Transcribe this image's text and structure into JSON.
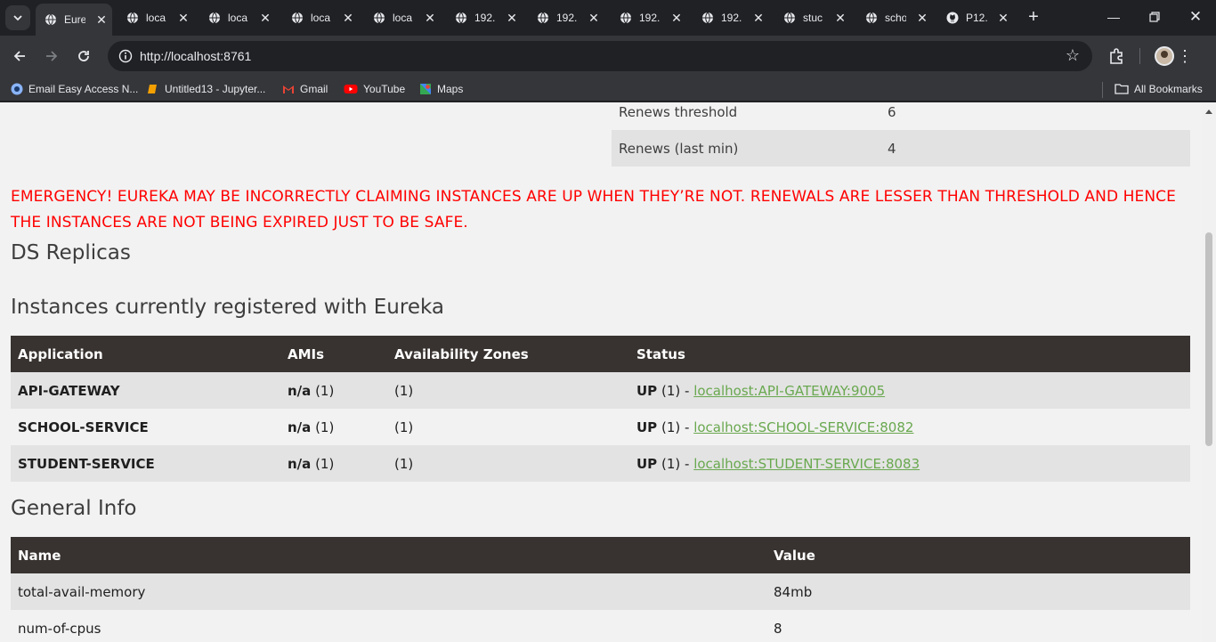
{
  "browser": {
    "tabs": [
      {
        "title": "Eure",
        "icon": "leaf-icon",
        "active": true
      },
      {
        "title": "loca",
        "icon": "globe-icon"
      },
      {
        "title": "loca",
        "icon": "globe-icon"
      },
      {
        "title": "loca",
        "icon": "globe-icon"
      },
      {
        "title": "loca",
        "icon": "globe-icon"
      },
      {
        "title": "192.",
        "icon": "globe-icon"
      },
      {
        "title": "192.",
        "icon": "globe-icon"
      },
      {
        "title": "192.",
        "icon": "globe-icon"
      },
      {
        "title": "192.",
        "icon": "globe-icon"
      },
      {
        "title": "stuc",
        "icon": "globe-icon"
      },
      {
        "title": "scho",
        "icon": "globe-icon"
      },
      {
        "title": "P12.",
        "icon": "github-icon"
      }
    ],
    "url": "http://localhost:8761",
    "bookmarks": [
      {
        "label": "Email Easy Access N...",
        "icon": "email-icon"
      },
      {
        "label": "Untitled13 - Jupyter...",
        "icon": "jupyter-icon"
      },
      {
        "label": "Gmail",
        "icon": "gmail-icon"
      },
      {
        "label": "YouTube",
        "icon": "youtube-icon"
      },
      {
        "label": "Maps",
        "icon": "maps-icon"
      }
    ],
    "all_bookmarks_label": "All Bookmarks"
  },
  "lease_stats": [
    {
      "key": "Renews threshold",
      "value": "6"
    },
    {
      "key": "Renews (last min)",
      "value": "4"
    }
  ],
  "emergency_message": "EMERGENCY! EUREKA MAY BE INCORRECTLY CLAIMING INSTANCES ARE UP WHEN THEY’RE NOT. RENEWALS ARE LESSER THAN THRESHOLD AND HENCE THE INSTANCES ARE NOT BEING EXPIRED JUST TO BE SAFE.",
  "ds_replicas_title": "DS Replicas",
  "instances": {
    "title": "Instances currently registered with Eureka",
    "headers": [
      "Application",
      "AMIs",
      "Availability Zones",
      "Status"
    ],
    "rows": [
      {
        "app": "API-GATEWAY",
        "ami": "n/a",
        "ami_count": "(1)",
        "zones": "(1)",
        "status": "UP",
        "status_count": "(1) -",
        "link": "localhost:API-GATEWAY:9005"
      },
      {
        "app": "SCHOOL-SERVICE",
        "ami": "n/a",
        "ami_count": "(1)",
        "zones": "(1)",
        "status": "UP",
        "status_count": "(1) -",
        "link": "localhost:SCHOOL-SERVICE:8082"
      },
      {
        "app": "STUDENT-SERVICE",
        "ami": "n/a",
        "ami_count": "(1)",
        "zones": "(1)",
        "status": "UP",
        "status_count": "(1) -",
        "link": "localhost:STUDENT-SERVICE:8083"
      }
    ]
  },
  "general_info": {
    "title": "General Info",
    "headers": [
      "Name",
      "Value"
    ],
    "rows": [
      {
        "name": "total-avail-memory",
        "value": "84mb"
      },
      {
        "name": "num-of-cpus",
        "value": "8"
      }
    ]
  },
  "colors": {
    "emergency": "#ff0000",
    "table_header": "#383330",
    "link": "#69a84f"
  }
}
